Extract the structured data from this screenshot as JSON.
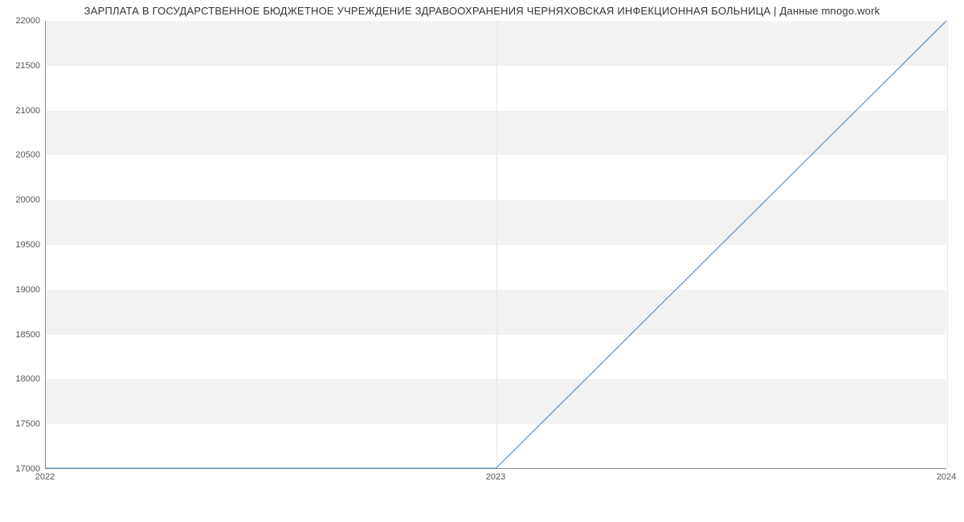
{
  "chart_data": {
    "type": "line",
    "title": "ЗАРПЛАТА В ГОСУДАРСТВЕННОЕ БЮДЖЕТНОЕ УЧРЕЖДЕНИЕ ЗДРАВООХРАНЕНИЯ ЧЕРНЯХОВСКАЯ ИНФЕКЦИОННАЯ БОЛЬНИЦА | Данные mnogo.work",
    "x": [
      2022,
      2023,
      2024
    ],
    "values": [
      17000,
      17000,
      22000
    ],
    "xlabel": "",
    "ylabel": "",
    "xlim": [
      2022,
      2024
    ],
    "ylim": [
      17000,
      22000
    ],
    "xticks": [
      2022,
      2023,
      2024
    ],
    "yticks": [
      17000,
      17500,
      18000,
      18500,
      19000,
      19500,
      20000,
      20500,
      21000,
      21500,
      22000
    ],
    "xtick_labels": [
      "2022",
      "2023",
      "2024"
    ],
    "ytick_labels": [
      "17000",
      "17500",
      "18000",
      "18500",
      "19000",
      "19500",
      "20000",
      "20500",
      "21000",
      "21500",
      "22000"
    ],
    "line_color": "#6699cc"
  }
}
